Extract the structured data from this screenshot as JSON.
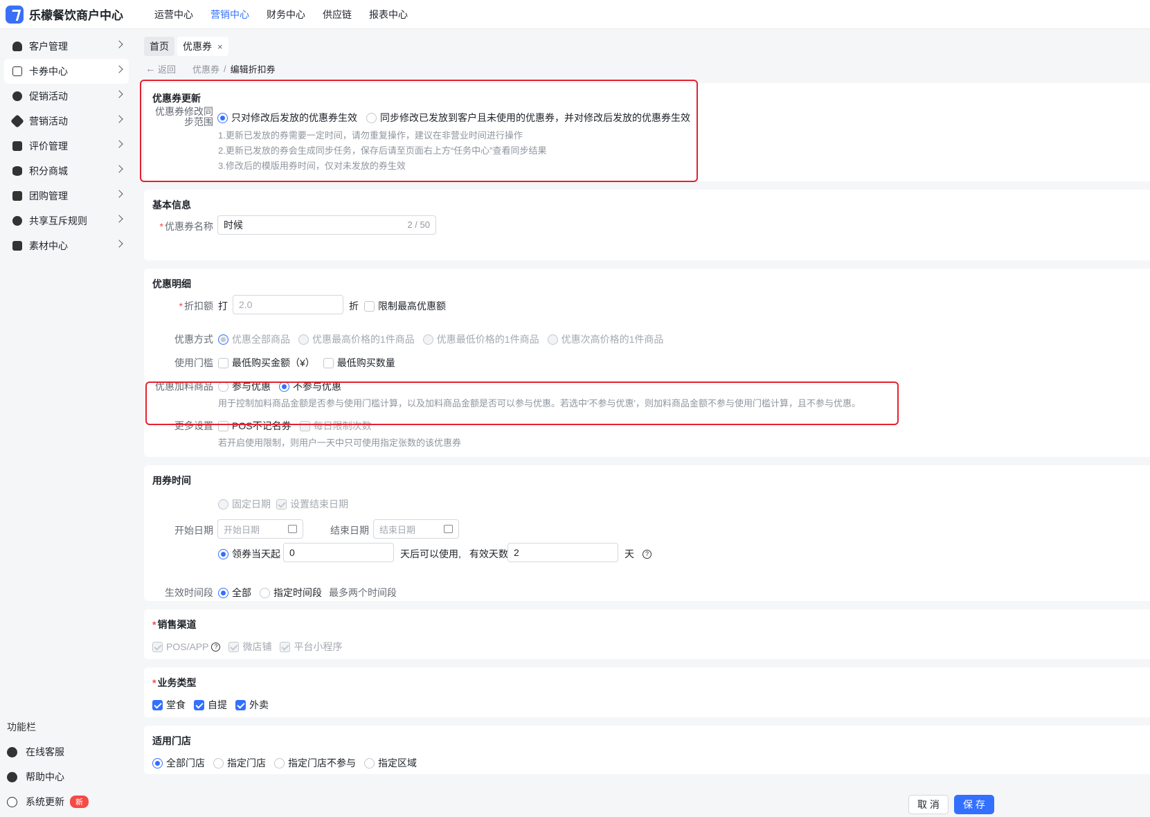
{
  "app": {
    "title": "乐檬餐饮商户中心"
  },
  "topnav": [
    "运营中心",
    "营销中心",
    "财务中心",
    "供应链",
    "报表中心"
  ],
  "topnav_active": 1,
  "sidebar": {
    "items": [
      "客户管理",
      "卡券中心",
      "促销活动",
      "营销活动",
      "评价管理",
      "积分商城",
      "团购管理",
      "共享互斥规则",
      "素材中心"
    ],
    "active": 1,
    "footer_title": "功能栏",
    "footer_items": [
      "在线客服",
      "帮助中心",
      "系统更新"
    ],
    "new_badge": "新"
  },
  "tabs": [
    {
      "label": "首页"
    },
    {
      "label": "优惠券",
      "close": "×"
    }
  ],
  "breadcrumb": {
    "back": "返回",
    "parent": "优惠券",
    "sep": "/",
    "current": "编辑折扣券"
  },
  "update": {
    "title": "优惠券更新",
    "label_line1": "优惠券修改同",
    "label_line2": "步范围",
    "opt1": "只对修改后发放的优惠券生效",
    "opt2": "同步修改已发放到客户且未使用的优惠券，并对修改后发放的优惠券生效",
    "hint1": "1.更新已发放的券需要一定时间，请勿重复操作，建议在非营业时间进行操作",
    "hint2": "2.更新已发放的券会生成同步任务，保存后请至页面右上方“任务中心”查看同步结果",
    "hint3": "3.修改后的模版用券时间，仅对未发放的券生效"
  },
  "basic": {
    "title": "基本信息",
    "name_label": "优惠券名称",
    "name_value": "时候",
    "name_count": "2 / 50"
  },
  "detail": {
    "title": "优惠明细",
    "discount_label": "折扣额",
    "prefix": "打",
    "discount_placeholder": "2.0",
    "suffix": "折",
    "limit_max": "限制最高优惠额",
    "method_label": "优惠方式",
    "methods": [
      "优惠全部商品",
      "优惠最高价格的1件商品",
      "优惠最低价格的1件商品",
      "优惠次高价格的1件商品"
    ],
    "threshold_label": "使用门槛",
    "threshold_opts": [
      "最低购买金额（¥）",
      "最低购买数量"
    ],
    "addon_label": "优惠加料商品",
    "addon_opts": [
      "参与优惠",
      "不参与优惠"
    ],
    "addon_hint": "用于控制加料商品金额是否参与使用门槛计算，以及加料商品金额是否可以参与优惠。若选中'不参与优惠'，则加料商品金额不参与使用门槛计算，且不参与优惠。",
    "more_label": "更多设置",
    "more_opts": [
      "POS不记名券",
      "每日限制次数"
    ],
    "more_hint": "若开启使用限制，则用户一天中只可使用指定张数的该优惠券"
  },
  "time": {
    "title": "用券时间",
    "fixed": "固定日期",
    "set_end": "设置结束日期",
    "start_label": "开始日期",
    "start_placeholder": "开始日期",
    "end_label": "结束日期",
    "end_placeholder": "结束日期",
    "from_day": "领券当天起",
    "days_after": "0",
    "after_text": "天后可以使用,",
    "valid_label": "有效天数",
    "valid_days": "2",
    "day_unit": "天",
    "period_label": "生效时间段",
    "period_all": "全部",
    "period_custom": "指定时间段",
    "period_hint": "最多两个时间段"
  },
  "channel": {
    "title": "销售渠道",
    "opts": [
      "POS/APP",
      "微店铺",
      "平台小程序"
    ]
  },
  "biz": {
    "title": "业务类型",
    "opts": [
      "堂食",
      "自提",
      "外卖"
    ]
  },
  "store": {
    "title": "适用门店",
    "opts": [
      "全部门店",
      "指定门店",
      "指定门店不参与",
      "指定区域"
    ]
  },
  "actions": {
    "cancel": "取 消",
    "save": "保 存"
  },
  "help_glyph": "?",
  "colors": {
    "primary": "#3370ff",
    "highlight": "#e5202e",
    "required": "#f54a45"
  }
}
